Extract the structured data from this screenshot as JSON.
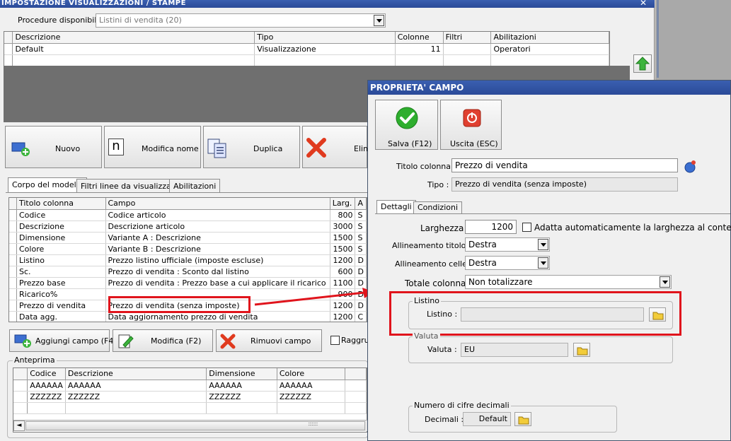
{
  "main": {
    "title": "IMPOSTAZIONE VISUALIZZAZIONI / STAMPE",
    "close_glyph": "✕",
    "procedure_label": "Procedure disponibili :",
    "procedure_value": "Listini di vendita (20)",
    "models_table": {
      "headers": [
        "Descrizione",
        "Tipo",
        "Colonne",
        "Filtri",
        "Abilitazioni"
      ],
      "rows": [
        [
          "Default",
          "Visualizzazione",
          "11",
          "",
          "Operatori"
        ]
      ]
    },
    "buttons": {
      "new": "Nuovo",
      "rename": "Modifica nome",
      "duplicate": "Duplica",
      "delete": "Elim"
    },
    "tabs": [
      "Corpo del modello",
      "Filtri linee da visualizzare",
      "Abilitazioni"
    ],
    "fields_table": {
      "headers": [
        "Titolo colonna",
        "Campo",
        "Larg.",
        "A"
      ],
      "rows": [
        [
          "Codice",
          "Codice articolo",
          "800",
          "S"
        ],
        [
          "Descrizione",
          "Descrizione articolo",
          "3000",
          "S"
        ],
        [
          "Dimensione",
          "Variante A : Descrizione",
          "1500",
          "S"
        ],
        [
          "Colore",
          "Variante B : Descrizione",
          "1500",
          "S"
        ],
        [
          "Listino",
          "Prezzo listino ufficiale (imposte escluse)",
          "1200",
          "D"
        ],
        [
          "Sc.",
          "Prezzo di vendita : Sconto dal listino",
          "600",
          "D"
        ],
        [
          "Prezzo base",
          "Prezzo di vendita : Prezzo base a cui applicare il ricarico",
          "1100",
          "D"
        ],
        [
          "Ricarico%",
          "",
          "900",
          "D"
        ],
        [
          "Prezzo di vendita",
          "Prezzo di vendita (senza imposte)",
          "1200",
          "D"
        ],
        [
          "Data agg.",
          "Data aggiornamento prezzo di vendita",
          "1200",
          "C"
        ]
      ]
    },
    "field_buttons": {
      "add": "Aggiungi campo (F4)",
      "edit": "Modifica (F2)",
      "remove": "Rimuovi campo",
      "group": "Raggru"
    },
    "preview": {
      "legend": "Anteprima",
      "headers": [
        "Codice",
        "Descrizione",
        "Dimensione",
        "Colore"
      ],
      "rows": [
        [
          "AAAAAA",
          "AAAAAA",
          "AAAAAA",
          "AAAAAA"
        ],
        [
          "ZZZZZZ",
          "ZZZZZZ",
          "ZZZZZZ",
          "ZZZZZZ"
        ]
      ],
      "scroll_left": "◄",
      "grip": "::::::::"
    }
  },
  "dialog": {
    "title": "PROPRIETA' CAMPO",
    "save": "Salva (F12)",
    "exit": "Uscita (ESC)",
    "title_label": "Titolo colonna :",
    "title_value": "Prezzo di vendita",
    "type_label": "Tipo :",
    "type_value": "Prezzo di vendita (senza imposte)",
    "tabs": [
      "Dettagli",
      "Condizioni"
    ],
    "width_label": "Larghezza :",
    "width_value": "1200",
    "autofit_label": "Adatta automaticamente la larghezza al contenuto",
    "title_align_label": "Allineamento titolo :",
    "title_align_value": "Destra",
    "cell_align_label": "Allineamento celle :",
    "cell_align_value": "Destra",
    "total_label": "Totale colonna :",
    "total_value": "Non totalizzare",
    "listino_group": "Listino",
    "listino_label": "Listino :",
    "listino_value": "",
    "valuta_group": "Valuta",
    "valuta_label": "Valuta :",
    "valuta_value": "EU",
    "decimals_group": "Numero di cifre decimali",
    "decimals_label": "Decimali :",
    "decimals_value": "Default"
  },
  "colors": {
    "title_bar": "#2a4a98",
    "highlight": "#e0141c",
    "save_green": "#2eae2e",
    "exit_red": "#e04030"
  }
}
